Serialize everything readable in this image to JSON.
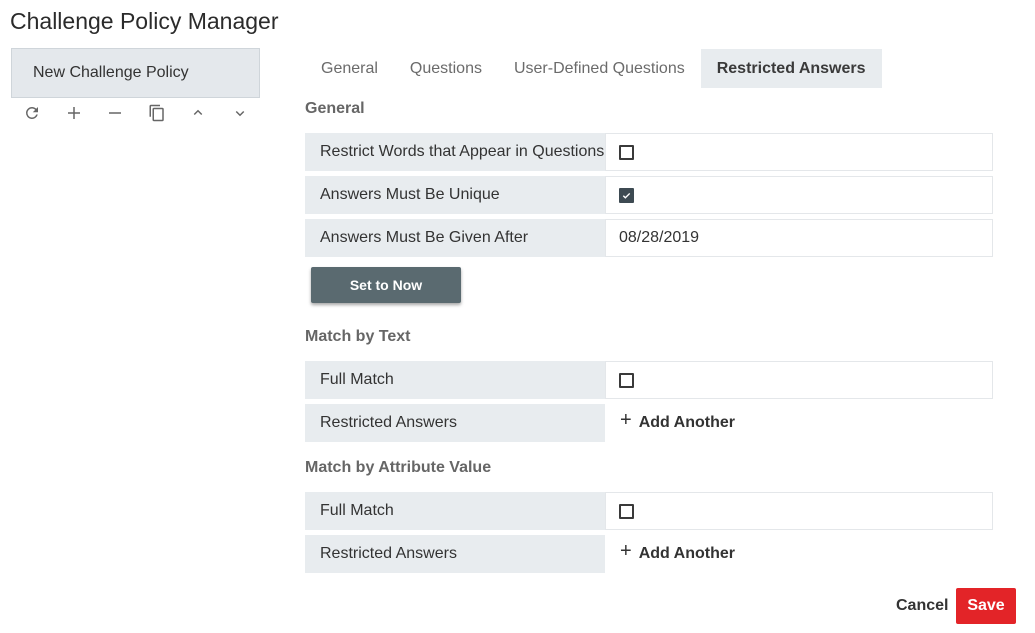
{
  "app": {
    "title": "Challenge Policy Manager"
  },
  "sidebar": {
    "items": [
      {
        "label": "New Challenge Policy"
      }
    ],
    "toolbar": [
      "refresh-icon",
      "plus-icon",
      "minus-icon",
      "copy-icon",
      "chevron-up-icon",
      "chevron-down-icon"
    ]
  },
  "tabs": [
    {
      "label": "General"
    },
    {
      "label": "Questions"
    },
    {
      "label": "User-Defined Questions"
    },
    {
      "label": "Restricted Answers",
      "active": true
    }
  ],
  "general": {
    "title": "General",
    "restrict_words": {
      "label": "Restrict Words that Appear in Questions",
      "checked": false
    },
    "unique": {
      "label": "Answers Must Be Unique",
      "checked": true
    },
    "given_after": {
      "label": "Answers Must Be Given After",
      "value": "08/28/2019"
    },
    "set_now_label": "Set to Now"
  },
  "match_text": {
    "title": "Match by Text",
    "full_match": {
      "label": "Full Match",
      "checked": false
    },
    "restricted": {
      "label": "Restricted Answers",
      "add_label": "Add Another"
    }
  },
  "match_attr": {
    "title": "Match by Attribute Value",
    "full_match": {
      "label": "Full Match",
      "checked": false
    },
    "restricted": {
      "label": "Restricted Answers",
      "add_label": "Add Another"
    }
  },
  "footer": {
    "cancel_label": "Cancel",
    "save_label": "Save"
  },
  "colors": {
    "accent": "#e32428",
    "button_dark": "#5a6a70",
    "label_bg": "#e8ecef"
  }
}
